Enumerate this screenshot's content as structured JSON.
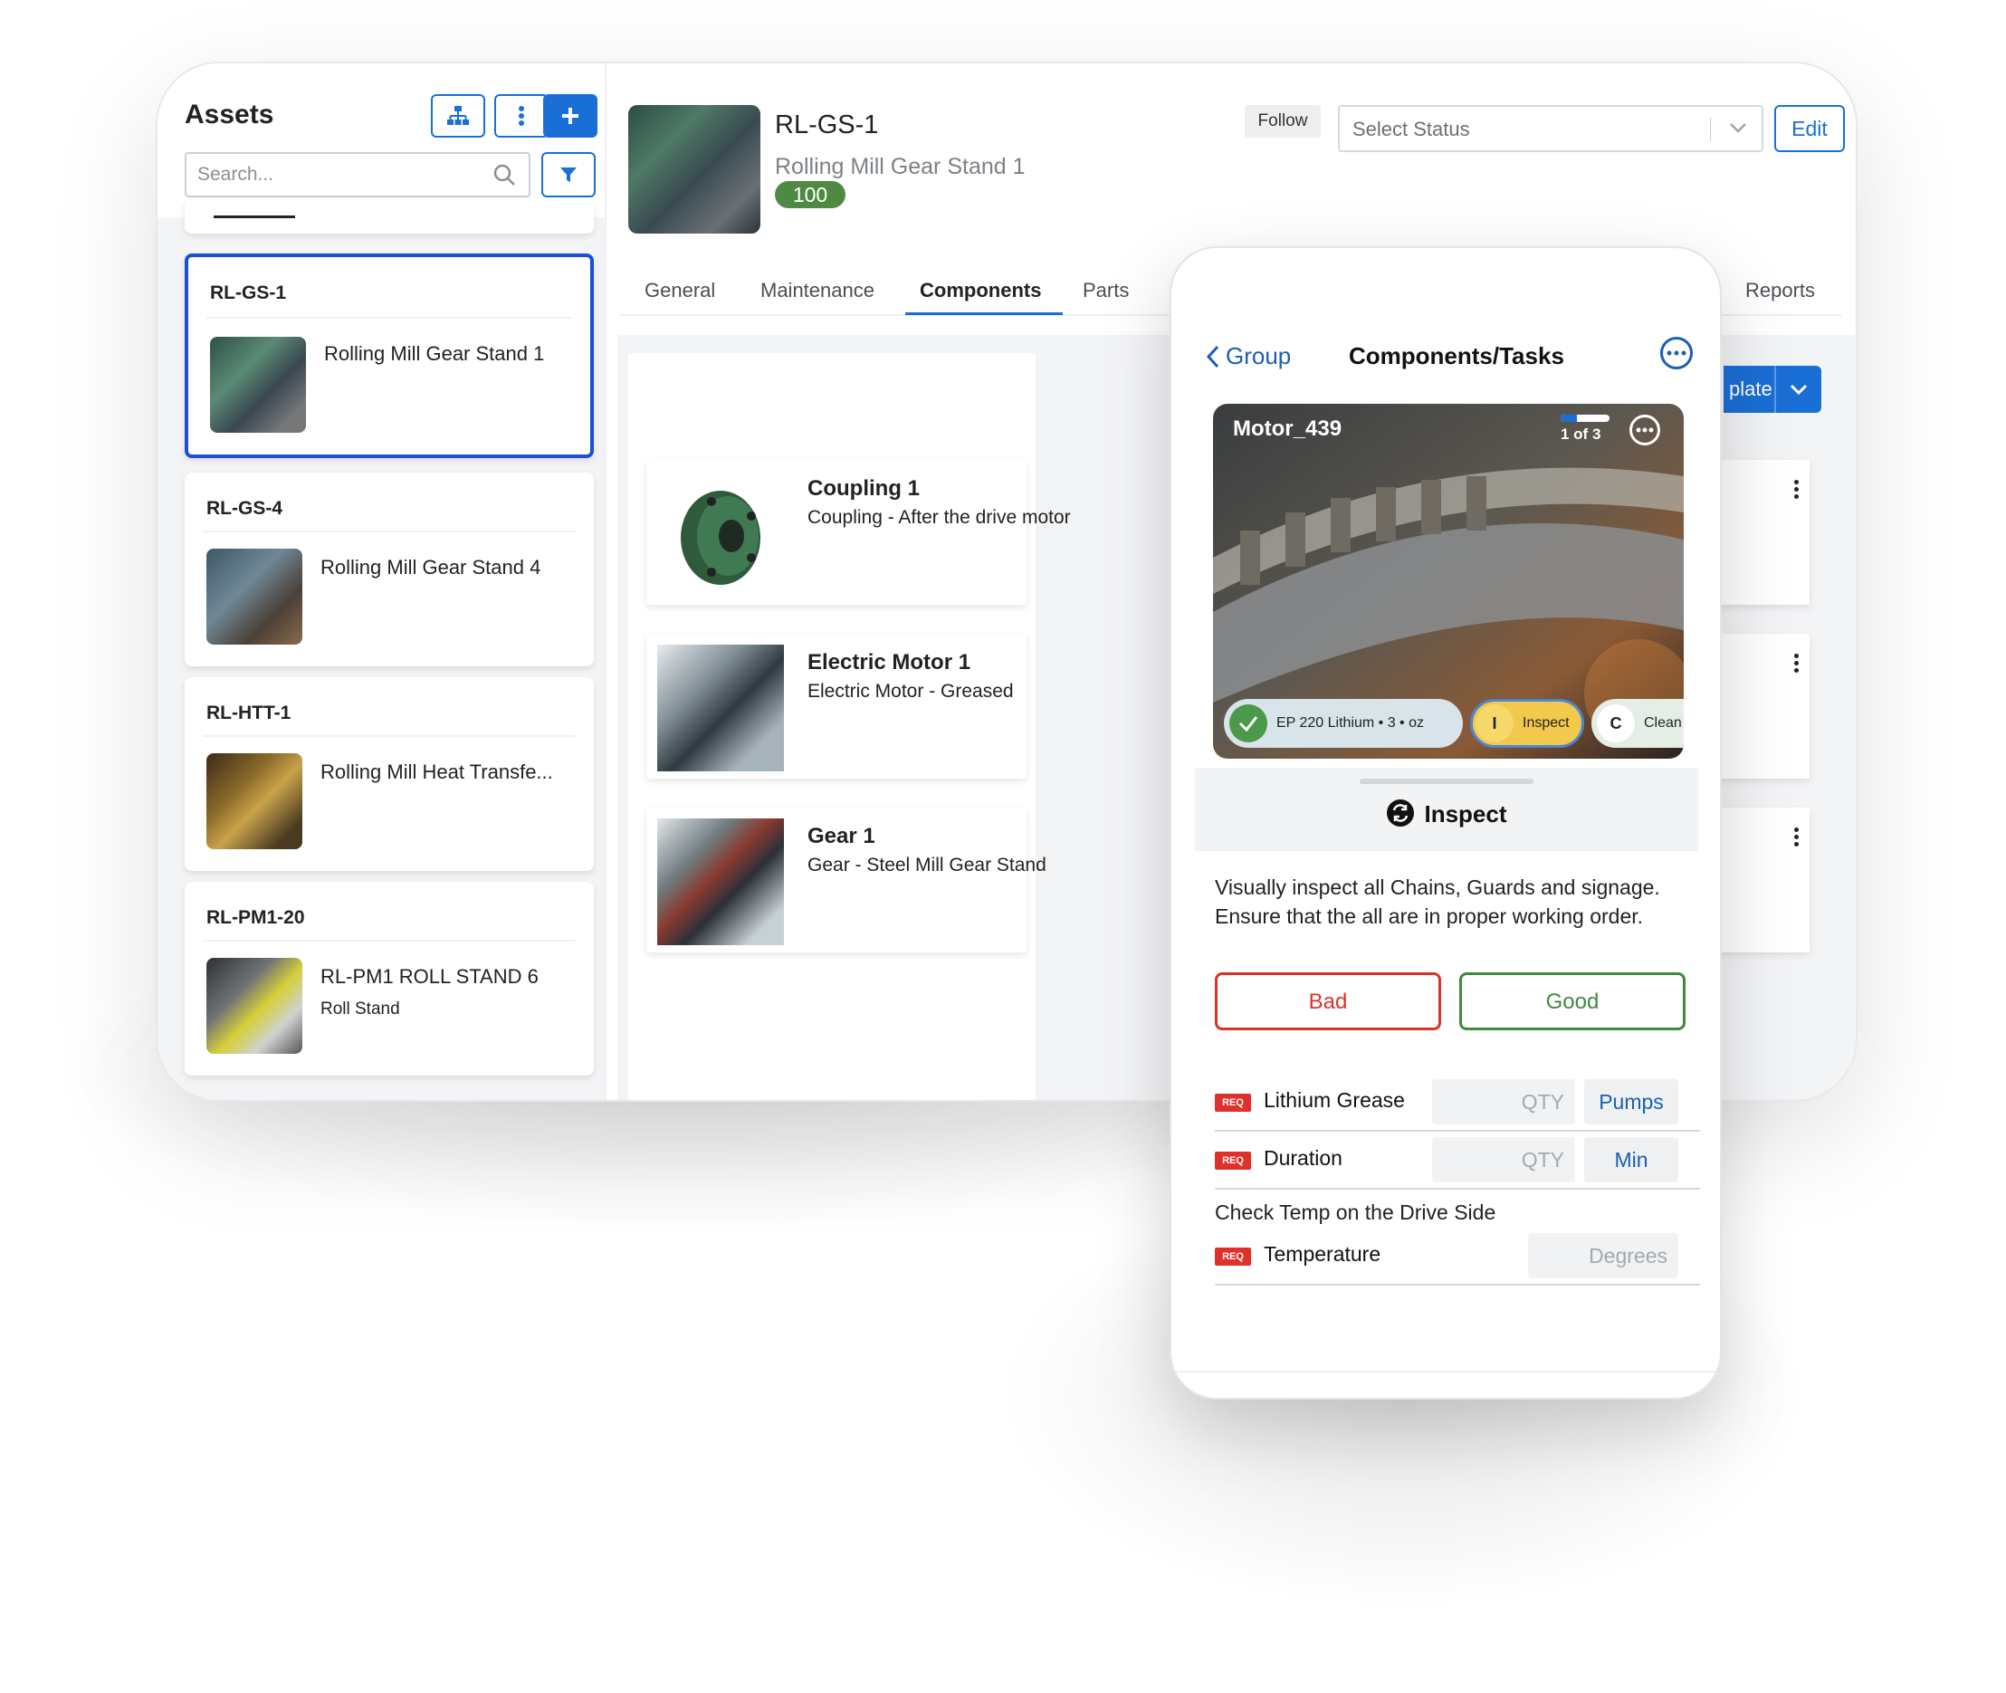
{
  "assets": {
    "title": "Assets",
    "search_placeholder": "Search...",
    "items": [
      {
        "id": "RL-GS-1",
        "name": "Rolling Mill Gear Stand 1",
        "sub": ""
      },
      {
        "id": "RL-GS-4",
        "name": "Rolling Mill Gear Stand 4",
        "sub": ""
      },
      {
        "id": "RL-HTT-1",
        "name": "Rolling Mill Heat Transfe...",
        "sub": ""
      },
      {
        "id": "RL-PM1-20",
        "name": "RL-PM1 ROLL STAND 6",
        "sub": "Roll Stand"
      }
    ]
  },
  "header": {
    "asset_id": "RL-GS-1",
    "asset_name": "Rolling Mill Gear Stand 1",
    "badge": "100",
    "follow_label": "Follow",
    "status_placeholder": "Select Status",
    "edit_label": "Edit"
  },
  "tabs": [
    "General",
    "Maintenance",
    "Components",
    "Parts",
    "Reports"
  ],
  "active_tab": "Components",
  "template_button_label": "plate",
  "components": [
    {
      "title": "Coupling 1",
      "desc": "Coupling - After the drive motor"
    },
    {
      "title": "Electric Motor 1",
      "desc": "Electric Motor - Greased"
    },
    {
      "title": "Gear 1",
      "desc": "Gear - Steel Mill Gear Stand"
    }
  ],
  "phone": {
    "back_label": "Group",
    "title": "Components/Tasks",
    "hero_title": "Motor_439",
    "progress_text": "1 of 3",
    "progress_fraction": 0.33,
    "chips": [
      {
        "icon": "check-icon",
        "label": "EP 220 Lithium • 3 • oz"
      },
      {
        "letter": "I",
        "label": "Inspect"
      },
      {
        "letter": "C",
        "label": "Clean"
      }
    ],
    "section_title": "Inspect",
    "description": "Visually inspect all Chains, Guards and signage. Ensure that the all are in proper working order.",
    "bad_label": "Bad",
    "good_label": "Good",
    "req_label": "REQ",
    "fields": [
      {
        "label": "Lithium Grease",
        "placeholder": "QTY",
        "unit": "Pumps"
      },
      {
        "label": "Duration",
        "placeholder": "QTY",
        "unit": "Min"
      }
    ],
    "note": "Check Temp on the Drive Side",
    "temp_field": {
      "label": "Temperature",
      "placeholder": "Degrees"
    }
  },
  "colors": {
    "accent": "#1a6fd6",
    "selected_border": "#1a4fd6",
    "badge": "#4f8a44",
    "bad": "#d9342b",
    "good": "#3f8a3f",
    "req": "#e0302b",
    "inspect_chip": "#f2c94c"
  }
}
